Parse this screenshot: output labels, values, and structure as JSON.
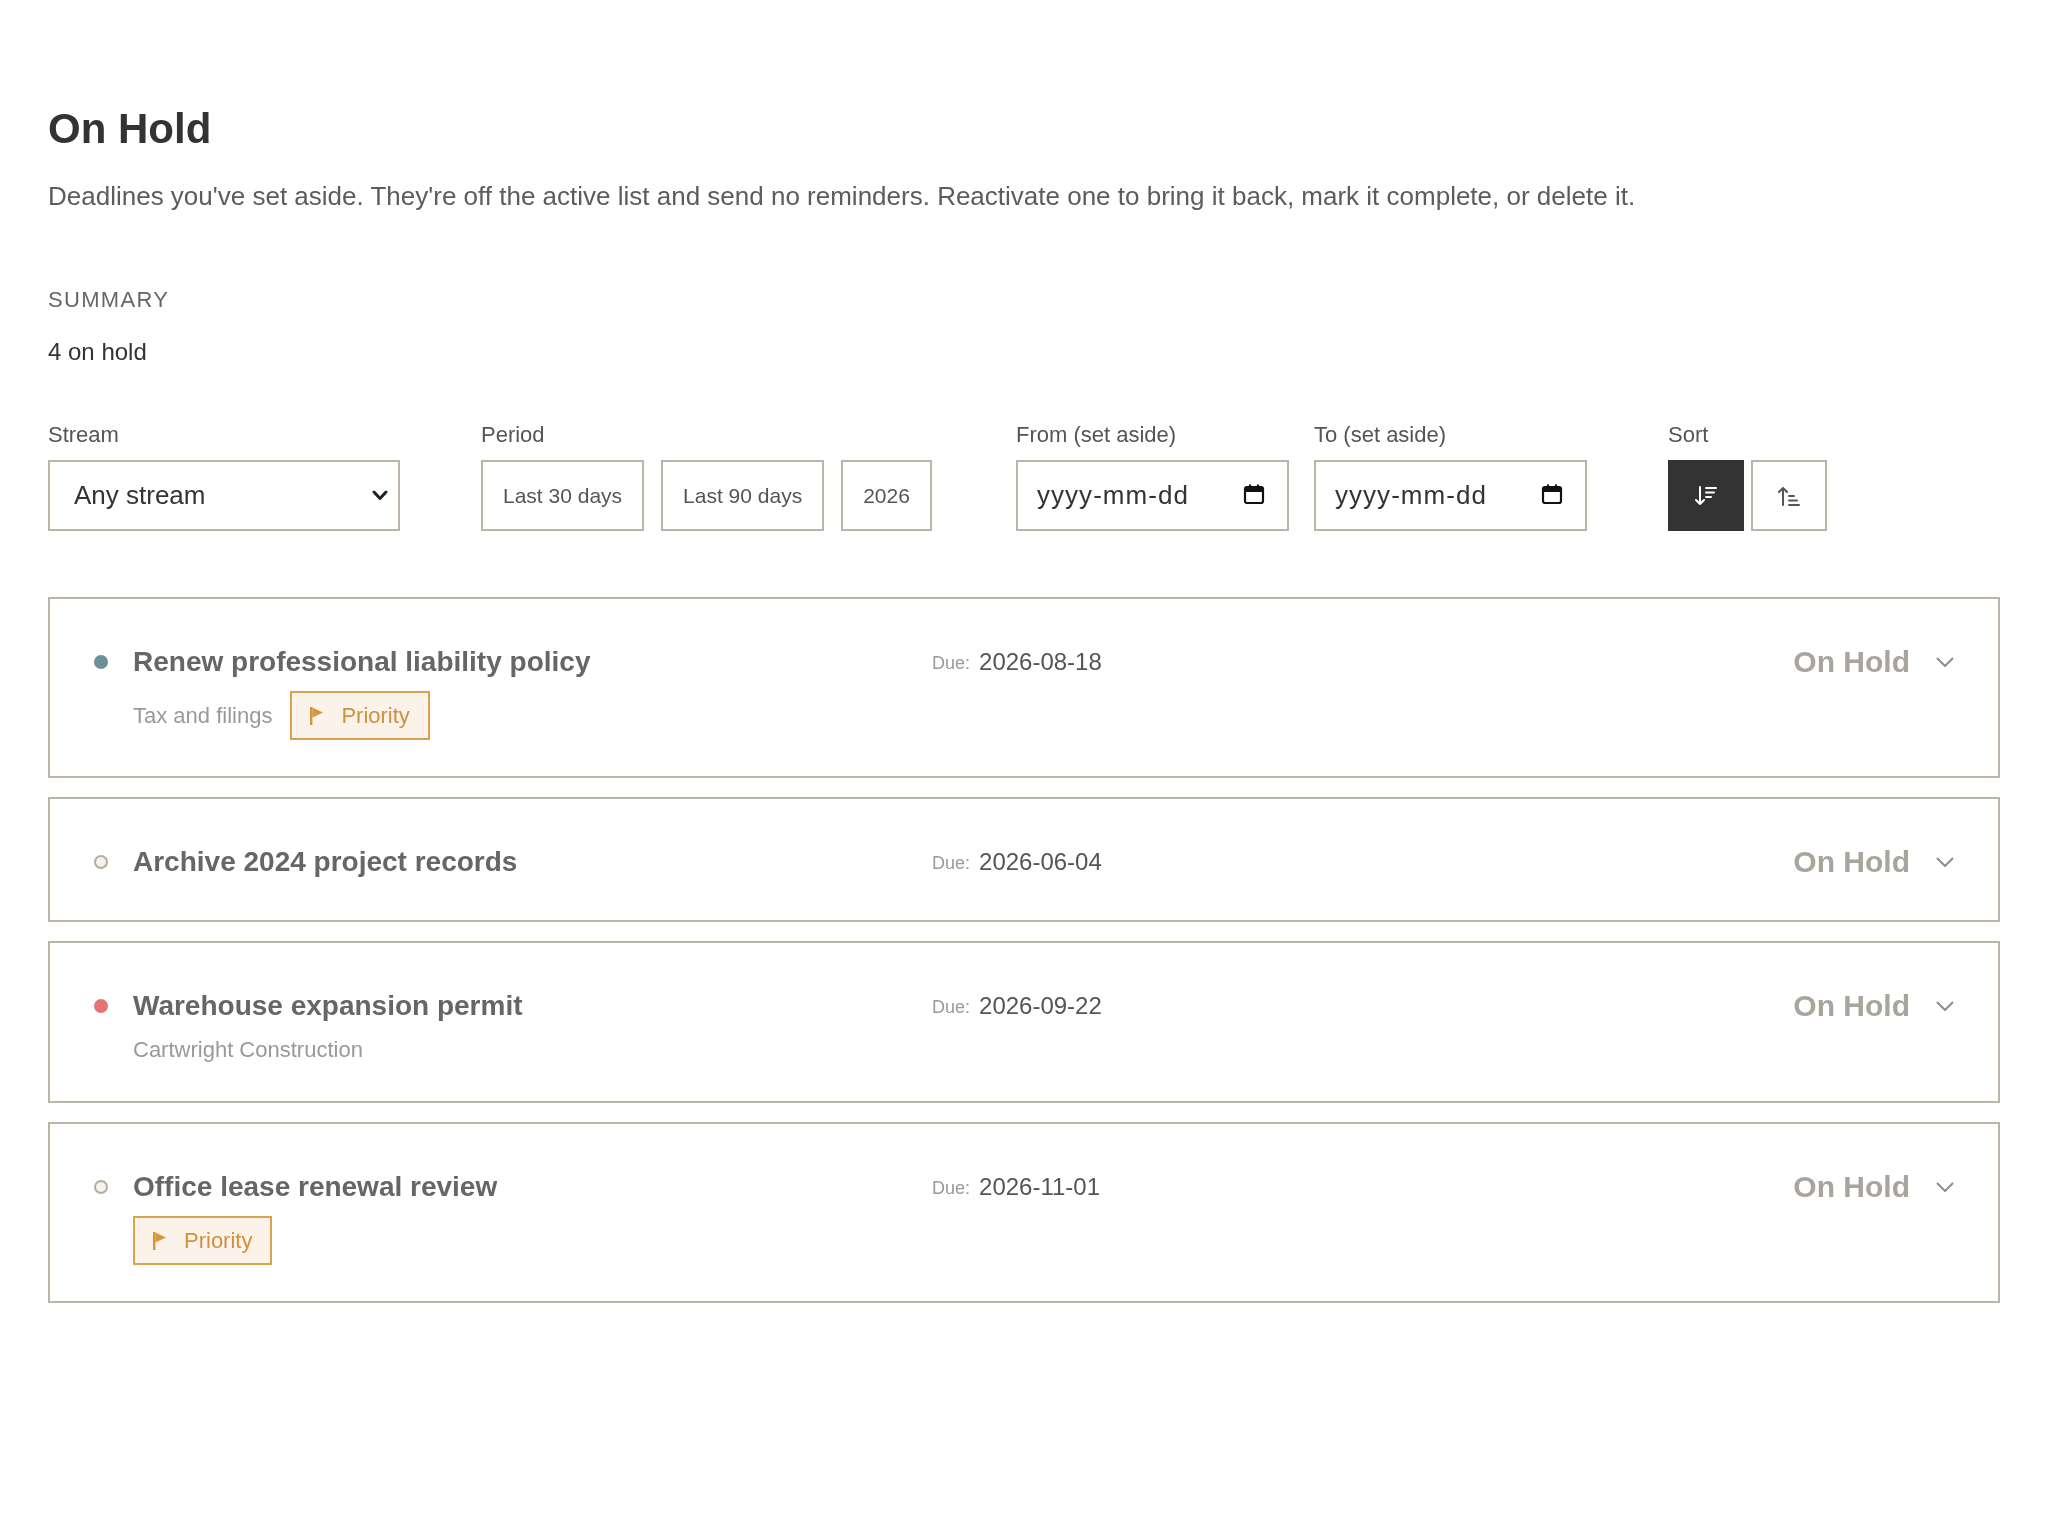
{
  "page": {
    "title": "On Hold",
    "description": "Deadlines you've set aside. They're off the active list and send no reminders. Reactivate one to bring it back, mark it complete, or delete it."
  },
  "summary": {
    "heading": "SUMMARY",
    "count": "4 on hold"
  },
  "filters": {
    "stream": {
      "label": "Stream",
      "value": "Any stream"
    },
    "period": {
      "label": "Period",
      "options": [
        {
          "label": "Last 30 days",
          "selected": false
        },
        {
          "label": "Last 90 days",
          "selected": false
        },
        {
          "label": "2026",
          "selected": false
        }
      ]
    },
    "from": {
      "label": "From (set aside)",
      "placeholder": "yyyy-mm-dd"
    },
    "to": {
      "label": "To (set aside)",
      "placeholder": "yyyy-mm-dd"
    },
    "sort": {
      "label": "Sort",
      "options": [
        {
          "kind": "descending",
          "selected": true
        },
        {
          "kind": "ascending",
          "selected": false
        }
      ]
    }
  },
  "deadlines": [
    {
      "title": "Renew professional liability policy",
      "color": "#6d8f99",
      "stream": "Tax and filings",
      "priority": "Priority",
      "due_label": "Due:",
      "due": "2026-08-18",
      "status": "On Hold"
    },
    {
      "title": "Archive 2024 project records",
      "due_label": "Due:",
      "due": "2026-06-04",
      "status": "On Hold"
    },
    {
      "title": "Warehouse expansion permit",
      "color": "#e57373",
      "stream": "Cartwright Construction",
      "due_label": "Due:",
      "due": "2026-09-22",
      "status": "On Hold"
    },
    {
      "title": "Office lease renewal review",
      "priority": "Priority",
      "due_label": "Due:",
      "due": "2026-11-01",
      "status": "On Hold"
    }
  ]
}
